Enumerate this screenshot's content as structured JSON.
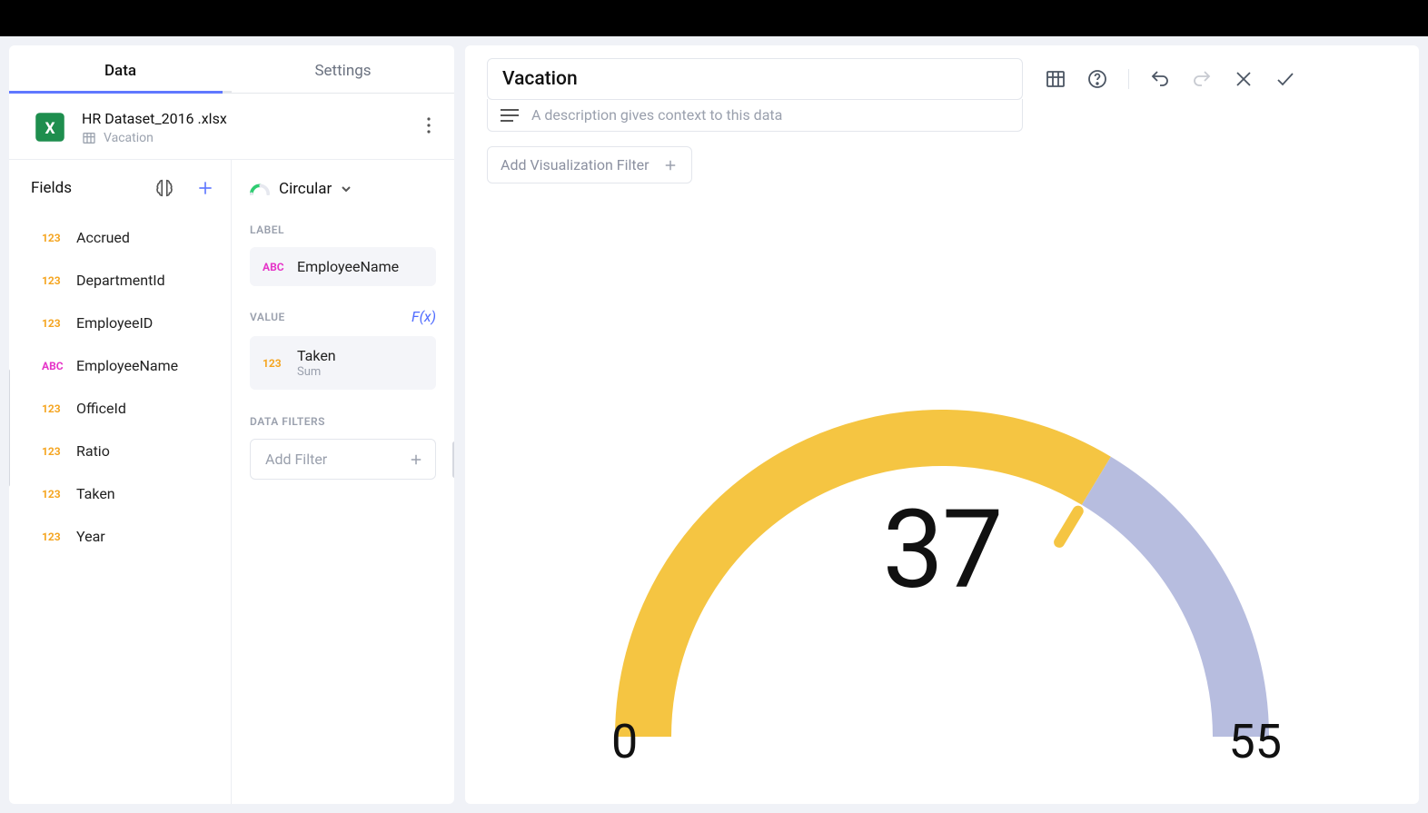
{
  "tabs": {
    "data": "Data",
    "settings": "Settings"
  },
  "dataset": {
    "file_name": "HR Dataset_2016 .xlsx",
    "table_name": "Vacation"
  },
  "fields": {
    "header": "Fields",
    "items": [
      {
        "type": "123",
        "label": "Accrued"
      },
      {
        "type": "123",
        "label": "DepartmentId"
      },
      {
        "type": "123",
        "label": "EmployeeID"
      },
      {
        "type": "ABC",
        "label": "EmployeeName"
      },
      {
        "type": "123",
        "label": "OfficeId"
      },
      {
        "type": "123",
        "label": "Ratio"
      },
      {
        "type": "123",
        "label": "Taken"
      },
      {
        "type": "123",
        "label": "Year"
      }
    ]
  },
  "config": {
    "chart_type": "Circular",
    "sections": {
      "label": {
        "title": "LABEL",
        "pill_type": "ABC",
        "pill_name": "EmployeeName"
      },
      "value": {
        "title": "VALUE",
        "fx": "F(x)",
        "pill_type": "123",
        "pill_name": "Taken",
        "pill_sub": "Sum"
      },
      "filters": {
        "title": "DATA FILTERS",
        "add_label": "Add Filter"
      }
    }
  },
  "main": {
    "title": "Vacation",
    "description_placeholder": "A description gives context to this data",
    "viz_filter_label": "Add Visualization Filter"
  },
  "chart_data": {
    "type": "gauge",
    "value": 37,
    "min": 0,
    "max": 55,
    "title": "Vacation",
    "value_label": "37",
    "min_label": "0",
    "max_label": "55",
    "colors": {
      "fill": "#f5c542",
      "track": "#b7bddf"
    }
  }
}
